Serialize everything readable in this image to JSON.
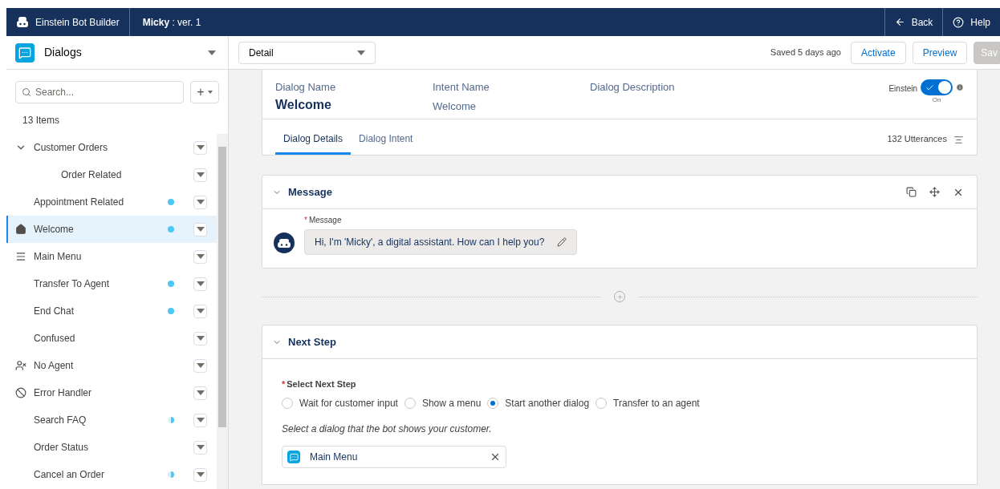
{
  "header": {
    "app_title": "Einstein Bot Builder",
    "bot_name": "Micky",
    "version": " : ver. 1",
    "actions": [
      {
        "kind": "back",
        "label": "Back"
      },
      {
        "kind": "help",
        "label": "Help"
      }
    ]
  },
  "sidebar": {
    "title": "Dialogs",
    "search": {
      "placeholder": "Search..."
    },
    "add_label": "+",
    "count": "13 Items",
    "items": [
      {
        "label": "Customer Orders",
        "selected": false,
        "dot": false,
        "expanded": true,
        "children": [
          {
            "label": "Order Related",
            "selected": false,
            "dot": false
          }
        ]
      },
      {
        "label": "Appointment Related",
        "selected": false,
        "dot": true,
        "partial": false
      },
      {
        "label": "Welcome",
        "kind": "home",
        "selected": true,
        "dot": true,
        "partial": false
      },
      {
        "label": "Main Menu",
        "kind": "menu",
        "selected": false,
        "dot": false
      },
      {
        "label": "Transfer To Agent",
        "selected": false,
        "dot": true,
        "partial": false
      },
      {
        "label": "End Chat",
        "selected": false,
        "dot": true,
        "partial": false
      },
      {
        "label": "Confused",
        "selected": false,
        "dot": false
      },
      {
        "label": "No Agent",
        "kind": "agent",
        "selected": false,
        "dot": false
      },
      {
        "label": "Error Handler",
        "kind": "error",
        "selected": false,
        "dot": false
      },
      {
        "label": "Search FAQ",
        "selected": false,
        "dot": true,
        "partial": true
      },
      {
        "label": "Order Status",
        "selected": false,
        "dot": false
      },
      {
        "label": "Cancel an Order",
        "selected": false,
        "dot": true,
        "partial": true
      }
    ]
  },
  "toolbar": {
    "view": "Detail",
    "saved": "Saved 5 days ago",
    "buttons": [
      {
        "label": "Activate",
        "disabled": false
      },
      {
        "label": "Preview",
        "disabled": false
      },
      {
        "label": "Sav",
        "disabled": true
      }
    ]
  },
  "dialog": {
    "fields": [
      {
        "label": "Dialog Name",
        "value": "Welcome",
        "kind": "title"
      },
      {
        "label": "Intent Name",
        "value": "Welcome",
        "kind": "plain"
      },
      {
        "label": "Dialog Description"
      }
    ],
    "einstein": {
      "label": "Einstein",
      "on": true,
      "state_label": "On"
    },
    "tabs": [
      {
        "label": "Dialog Details",
        "selected": true
      },
      {
        "label": "Dialog Intent",
        "selected": false
      }
    ],
    "utterances": "132 Utterances"
  },
  "message_step": {
    "title": "Message",
    "required_mark": "*",
    "field_label": "Message",
    "text": "Hi, I'm 'Micky', a digital assistant. How can I help you?"
  },
  "next_step": {
    "title": "Next Step",
    "required_mark": "*",
    "field_label": "Select Next Step",
    "options": [
      {
        "label": "Wait for customer input",
        "selected": false
      },
      {
        "label": "Show a menu",
        "selected": false
      },
      {
        "label": "Start another dialog",
        "selected": true
      },
      {
        "label": "Transfer to an agent",
        "selected": false
      }
    ],
    "hint": "Select a dialog that the bot shows your customer.",
    "chosen_dialog": "Main Menu"
  }
}
